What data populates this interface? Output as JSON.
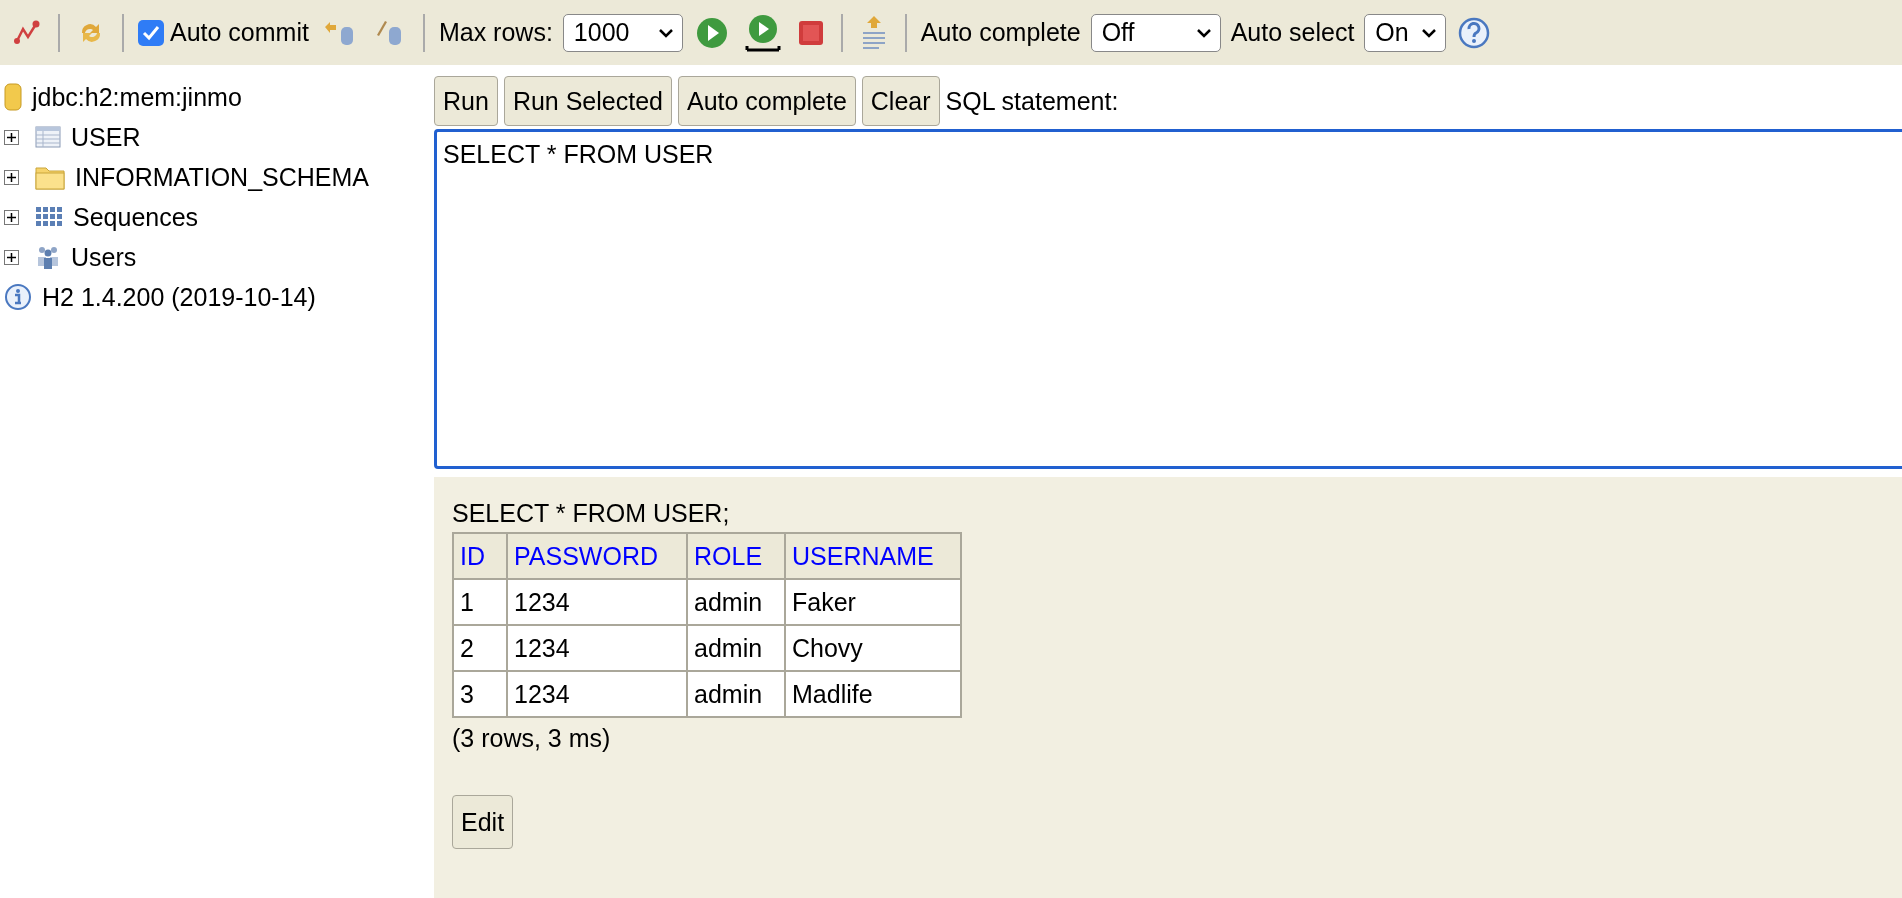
{
  "toolbar": {
    "auto_commit": {
      "label": "Auto commit",
      "checked": true
    },
    "max_rows": {
      "label": "Max rows:",
      "value": "1000"
    },
    "auto_complete": {
      "label": "Auto complete",
      "value": "Off"
    },
    "auto_select": {
      "label": "Auto select",
      "value": "On"
    }
  },
  "tree": {
    "connection": "jdbc:h2:mem:jinmo",
    "items": [
      {
        "kind": "table",
        "label": "USER",
        "expanded": false
      },
      {
        "kind": "schema",
        "label": "INFORMATION_SCHEMA",
        "expanded": false
      },
      {
        "kind": "sequences",
        "label": "Sequences",
        "expanded": false
      },
      {
        "kind": "users",
        "label": "Users",
        "expanded": false
      }
    ],
    "version": "H2 1.4.200 (2019-10-14)"
  },
  "editor": {
    "buttons": [
      "Run",
      "Run Selected",
      "Auto complete",
      "Clear"
    ],
    "label": "SQL statement:",
    "value": "SELECT * FROM USER"
  },
  "result": {
    "statement": "SELECT * FROM USER;",
    "columns": [
      "ID",
      "PASSWORD",
      "ROLE",
      "USERNAME"
    ],
    "rows": [
      [
        "1",
        "1234",
        "admin",
        "Faker"
      ],
      [
        "2",
        "1234",
        "admin",
        "Chovy"
      ],
      [
        "3",
        "1234",
        "admin",
        "Madlife"
      ]
    ],
    "summary": "(3 rows, 3 ms)",
    "edit_button": "Edit"
  }
}
